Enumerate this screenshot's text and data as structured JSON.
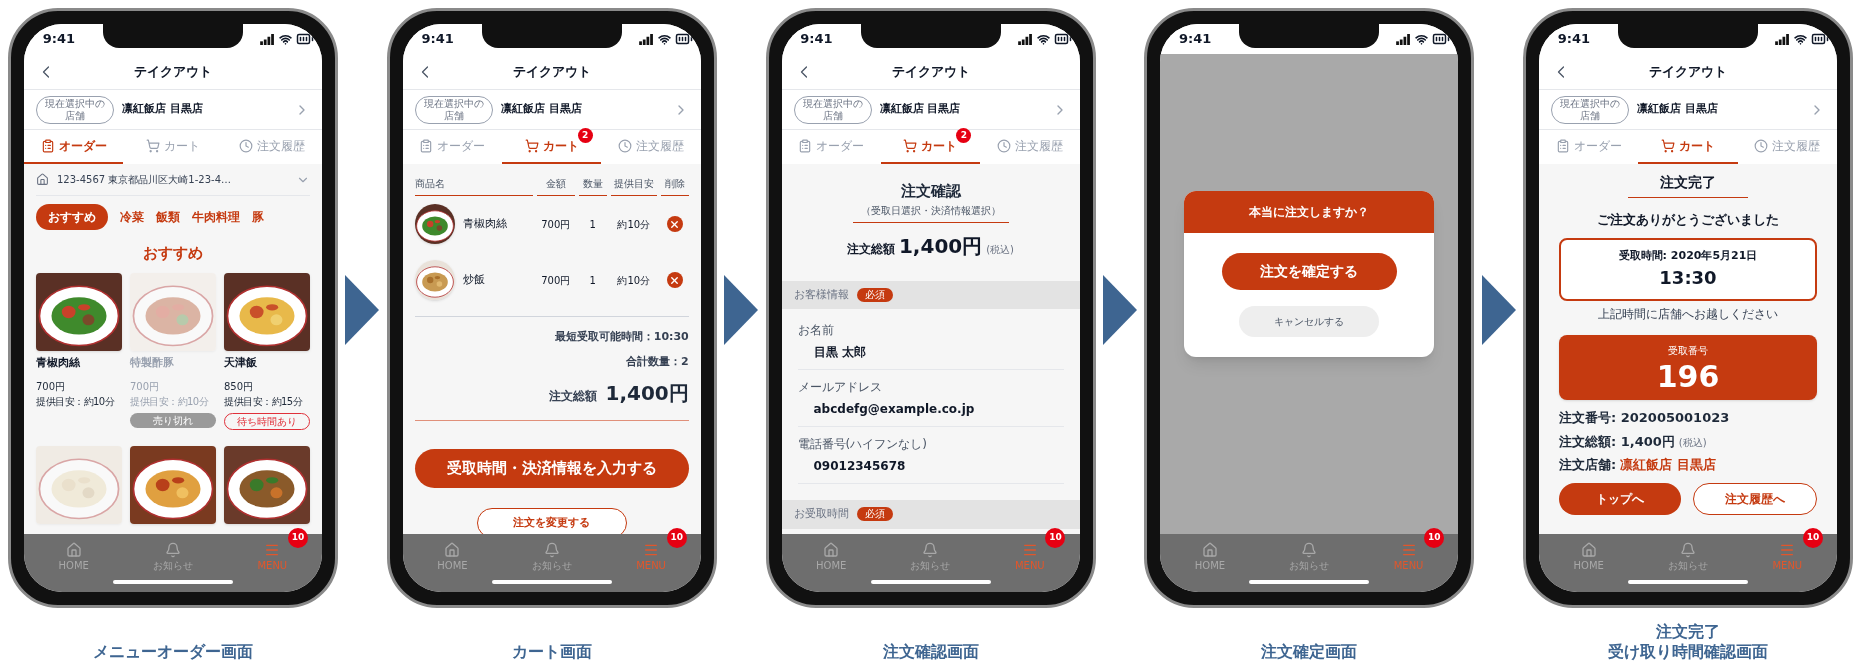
{
  "screens": [
    {
      "kind": "menu",
      "caption": [
        "メニューオーダー画面"
      ],
      "status": {
        "time": "9:41"
      },
      "header": {
        "title": "テイクアウト"
      },
      "store": {
        "badge": [
          "現在選択中の",
          "店舗"
        ],
        "name": "凛紅飯店 目黒店"
      },
      "tabs": [
        {
          "label": "オーダー",
          "selected": true
        },
        {
          "label": "カート",
          "selected": false
        },
        {
          "label": "注文履歴",
          "selected": false
        }
      ],
      "address": "123-4567 東京都品川区大崎1-23-4…",
      "categories": [
        {
          "label": "おすすめ",
          "selected": true
        },
        {
          "label": "冷菜",
          "selected": false
        },
        {
          "label": "飯類",
          "selected": false
        },
        {
          "label": "牛肉料理",
          "selected": false
        },
        {
          "label": "豚",
          "selected": false
        }
      ],
      "section_title": "おすすめ",
      "items": [
        {
          "kind": "dish",
          "name": "青椒肉絲",
          "price": "700円",
          "time": "提供目安：約10分",
          "available": true
        },
        {
          "kind": "dish",
          "name": "特製酢豚",
          "price": "700円",
          "time": "提供目安：約10分",
          "available": false,
          "tag": {
            "kind": "sold_out",
            "label": "売り切れ"
          }
        },
        {
          "kind": "dish",
          "name": "天津飯",
          "price": "850円",
          "time": "提供目安：約15分",
          "available": true,
          "tag": {
            "kind": "wait",
            "label": "待ち時間あり"
          }
        },
        {
          "kind": "picture",
          "available": false
        },
        {
          "kind": "picture",
          "available": true
        },
        {
          "kind": "picture",
          "available": true
        }
      ],
      "nav": [
        {
          "label": "HOME",
          "selected": false
        },
        {
          "label": "お知らせ",
          "selected": false
        },
        {
          "label": "MENU",
          "selected": true,
          "badge": "10"
        }
      ]
    },
    {
      "kind": "cart",
      "caption": [
        "カート画面"
      ],
      "status": {
        "time": "9:41"
      },
      "header": {
        "title": "テイクアウト"
      },
      "store": {
        "badge": [
          "現在選択中の",
          "店舗"
        ],
        "name": "凛紅飯店 目黒店"
      },
      "tabs": [
        {
          "label": "オーダー",
          "selected": false
        },
        {
          "label": "カート",
          "selected": true,
          "badge": "2"
        },
        {
          "label": "注文履歴",
          "selected": false
        }
      ],
      "columns": [
        "商品名",
        "金額",
        "数量",
        "提供目安",
        "削除"
      ],
      "rows": [
        {
          "name": "青椒肉絲",
          "price": "700円",
          "qty": "1",
          "time": "約10分"
        },
        {
          "name": "炒飯",
          "price": "700円",
          "qty": "1",
          "time": "約10分"
        }
      ],
      "summary": {
        "earliest": "最短受取可能時間：10:30",
        "count": "合計数量：2",
        "total_label": "注文総額",
        "total": "1,400円"
      },
      "primary_button": "受取時間・決済情報を入力する",
      "secondary_button": "注文を変更する",
      "nav": [
        {
          "label": "HOME",
          "selected": false
        },
        {
          "label": "お知らせ",
          "selected": false
        },
        {
          "label": "MENU",
          "selected": true,
          "badge": "10"
        }
      ]
    },
    {
      "kind": "confirm",
      "caption": [
        "注文確認画面"
      ],
      "status": {
        "time": "9:41"
      },
      "header": {
        "title": "テイクアウト"
      },
      "store": {
        "badge": [
          "現在選択中の",
          "店舗"
        ],
        "name": "凛紅飯店 目黒店"
      },
      "tabs": [
        {
          "label": "オーダー",
          "selected": false
        },
        {
          "label": "カート",
          "selected": true,
          "badge": "2"
        },
        {
          "label": "注文履歴",
          "selected": false
        }
      ],
      "title": "注文確認",
      "subtitle": "（受取日選択・決済情報選択）",
      "total_label": "注文総額",
      "total": "1,400円",
      "tax_note": "(税込)",
      "sections": [
        {
          "title": "お客様情報",
          "required": "必須",
          "fields": [
            {
              "label": "お名前",
              "value": "目黒 太郎"
            },
            {
              "label": "メールアドレス",
              "value": "abcdefg@example.co.jp"
            },
            {
              "label": "電話番号(ハイフンなし)",
              "value": "09012345678"
            }
          ]
        },
        {
          "title": "お受取時間",
          "required": "必須"
        }
      ],
      "nav": [
        {
          "label": "HOME",
          "selected": false
        },
        {
          "label": "お知らせ",
          "selected": false
        },
        {
          "label": "MENU",
          "selected": true,
          "badge": "10"
        }
      ]
    },
    {
      "kind": "dialog",
      "caption": [
        "注文確定画面"
      ],
      "status": {
        "time": "9:41"
      },
      "dialog": {
        "title": "本当に注文しますか？",
        "confirm": "注文を確定する",
        "cancel": "キャンセルする"
      },
      "nav": [
        {
          "label": "HOME",
          "selected": false
        },
        {
          "label": "お知らせ",
          "selected": false
        },
        {
          "label": "MENU",
          "selected": true,
          "badge": "10"
        }
      ]
    },
    {
      "kind": "complete",
      "caption": [
        "注文完了",
        "受け取り時間確認画面"
      ],
      "status": {
        "time": "9:41"
      },
      "header": {
        "title": "テイクアウト"
      },
      "store": {
        "badge": [
          "現在選択中の",
          "店舗"
        ],
        "name": "凛紅飯店 目黒店"
      },
      "tabs": [
        {
          "label": "オーダー",
          "selected": false
        },
        {
          "label": "カート",
          "selected": true
        },
        {
          "label": "注文履歴",
          "selected": false
        }
      ],
      "title": "注文完了",
      "thanks": "ご注文ありがとうございました",
      "pickup": {
        "label": "受取時間: 2020年5月21日",
        "time": "13:30"
      },
      "pickup_note": "上記時間に店舗へお越しください",
      "number": {
        "label": "受取番号",
        "value": "196"
      },
      "details": [
        {
          "label": "注文番号: 202005001023"
        },
        {
          "label": "注文総額: 1,400円",
          "note": "(税込)"
        },
        {
          "label": "注文店舗:",
          "value": "凛紅飯店 目黒店"
        }
      ],
      "buttons": [
        {
          "kind": "filled",
          "label": "トップへ"
        },
        {
          "kind": "outline",
          "label": "注文履歴へ"
        }
      ],
      "nav": [
        {
          "label": "HOME",
          "selected": false
        },
        {
          "label": "お知らせ",
          "selected": false
        },
        {
          "label": "MENU",
          "selected": true,
          "badge": "10"
        }
      ]
    }
  ]
}
